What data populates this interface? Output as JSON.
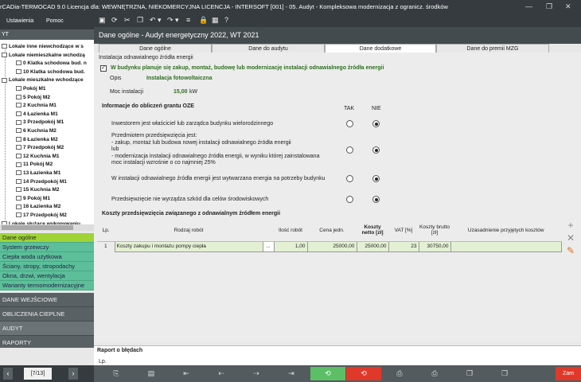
{
  "window": {
    "title": "rCADia-TERMOCAD 9.0 Licencja dla: WEWNĘTRZNA, NIEKOMERCYJNA LICENCJA - INTERSOFT [001] - 05. Audyt - Kompleksowa modernizacja z ogranicz. środków",
    "minimize": "—",
    "maximize": "❐",
    "close": "✕"
  },
  "menu": {
    "settings": "Ustawienia",
    "help": "Pomoc"
  },
  "header": {
    "title": "Dane ogólne - Audyt energetyczny 2022, WT 2021"
  },
  "tree": {
    "section": "YT",
    "items": [
      {
        "label": "Lokale inne niewchodzące w s",
        "indent": 0
      },
      {
        "label": "Lokale niemieszkalne wchodzą",
        "indent": 0
      },
      {
        "label": "0 Klatka schodowa bud. n",
        "indent": 2
      },
      {
        "label": "10 Klatka schodowa bud.",
        "indent": 2
      },
      {
        "label": "Lokale mieszkalne wchodzące",
        "indent": 0
      },
      {
        "label": "Pokój M1",
        "indent": 2
      },
      {
        "label": "5 Pokój M2",
        "indent": 2
      },
      {
        "label": "2 Kuchnia M1",
        "indent": 2
      },
      {
        "label": "4 Łazienka M1",
        "indent": 2
      },
      {
        "label": "3 Przedpokój M1",
        "indent": 2
      },
      {
        "label": "6 Kuchnia M2",
        "indent": 2
      },
      {
        "label": "8 Łazienka M2",
        "indent": 2
      },
      {
        "label": "7 Przedpokój M2",
        "indent": 2
      },
      {
        "label": "12 Kuchnia M1",
        "indent": 2
      },
      {
        "label": "11 Pokój M2",
        "indent": 2
      },
      {
        "label": "13 Łazienka M1",
        "indent": 2
      },
      {
        "label": "14 Przedpokój M1",
        "indent": 2
      },
      {
        "label": "15 Kuchnia M2",
        "indent": 2
      },
      {
        "label": "9 Pokój M1",
        "indent": 2
      },
      {
        "label": "16 Łazienka M2",
        "indent": 2
      },
      {
        "label": "17 Przedpokój M2",
        "indent": 2
      },
      {
        "label": "Lokale służące wykonywaniu",
        "indent": 0
      }
    ]
  },
  "nav_green": [
    "Dane ogólne",
    "System grzewczy",
    "Ciepła woda użytkowa",
    "Ściany, stropy, stropodachy",
    "Okna, drzwi, wentylacja",
    "Warianty termomodernizacyjne"
  ],
  "nav_dark": [
    "DANE WEJŚCIOWE",
    "OBLICZENIA CIEPLNE",
    "AUDYT",
    "RAPORTY"
  ],
  "pager": {
    "value": "[7/13]"
  },
  "tabs": [
    "Dane ogólne",
    "Dane do audytu",
    "Dane dodatkowe",
    "Dane do premii MZG"
  ],
  "oze": {
    "section_title": "Instalacja odnawialnego źródła energii",
    "checkbox_label": "W budynku planuje się zakup, montaż, budowę lub modernizację instalacji odnawialnego źródła energii",
    "checkbox_mark": "✓",
    "opis_label": "Opis",
    "opis_value": "Instalacja fotowoltaiczna",
    "moc_label": "Moc instalacji",
    "moc_value": "15,00",
    "moc_unit": "kW",
    "info_title": "Informacje do obliczeń grantu OZE",
    "tak": "TAK",
    "nie": "NIE",
    "questions": [
      {
        "text": "Inwestorem jest właściciel lub zarządca budynku wielorodzinnego",
        "answer": "NIE"
      },
      {
        "text": "Przedmiotem przedsięwzięcia jest:\n- zakup, montaż lub budowa nowej instalacji odnawialnego źródła energii\n     lub\n- modernizacja instalacji odnawialnego źródła energii, w wyniku której zainstalowana\n  moc instalacji wzrośnie o co najmniej 25%",
        "answer": "NIE"
      },
      {
        "text": "W instalacji odnawialnego źródła energii jest wytwarzana energia na potrzeby budynku",
        "answer": "NIE"
      },
      {
        "text": "Przedsięwzięcie nie wyrządza szkód dla celów środowiskowych",
        "answer": "NIE"
      }
    ]
  },
  "costs": {
    "title": "Koszty przedsięwzięcia związanego z odnawialnym źródłem energii",
    "headers": {
      "lp": "Lp.",
      "rodzaj": "Rodzaj robót",
      "ilosc": "Ilość robót",
      "cena": "Cena jedn.",
      "netto": "Koszty netto [zł]",
      "vat": "VAT [%]",
      "brutto": "Koszty brutto [zł]",
      "uzasad": "Uzasadnienie przyjętych kosztów"
    },
    "rows": [
      {
        "lp": "1",
        "rodzaj": "Koszty zakupu i montażu pompy ciepła",
        "btn": "...",
        "ilosc": "1,00",
        "cena": "25000,00",
        "netto": "25000,00",
        "vat": "23",
        "brutto": "30750,00",
        "uzasad": ""
      }
    ]
  },
  "report": {
    "title": "Raport o błędach",
    "lp": "Lp."
  },
  "bottom": {
    "close_label": "Zam"
  }
}
